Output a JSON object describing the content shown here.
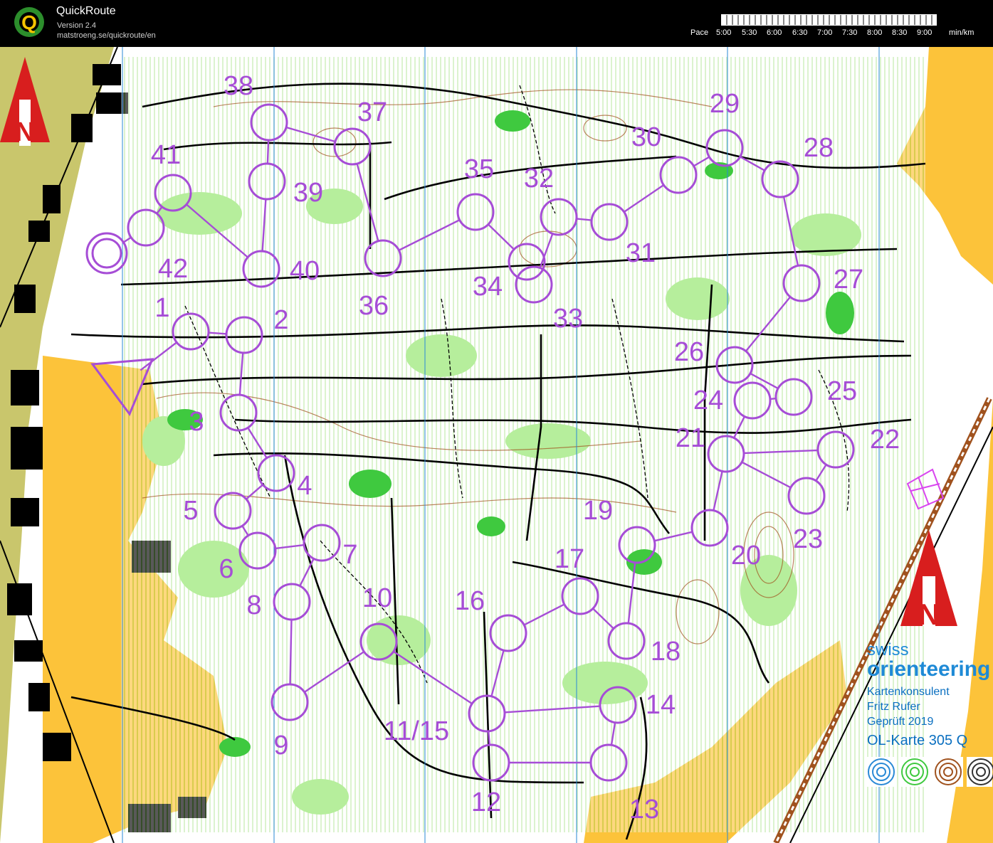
{
  "app": {
    "title": "QuickRoute",
    "version": "Version 2.4",
    "url": "matstroeng.se/quickroute/en"
  },
  "pace_scale": {
    "label": "Pace",
    "ticks": [
      "5:00",
      "5:30",
      "6:00",
      "6:30",
      "7:00",
      "7:30",
      "8:00",
      "8:30",
      "9:00"
    ],
    "unit": "min/km"
  },
  "course": {
    "color": "#a64dd6",
    "controls": [
      {
        "label": "1"
      },
      {
        "label": "2"
      },
      {
        "label": "3"
      },
      {
        "label": "4"
      },
      {
        "label": "5"
      },
      {
        "label": "6"
      },
      {
        "label": "7"
      },
      {
        "label": "8"
      },
      {
        "label": "9"
      },
      {
        "label": "10"
      },
      {
        "label": "11/15"
      },
      {
        "label": "12"
      },
      {
        "label": "13"
      },
      {
        "label": "14"
      },
      {
        "label": "16"
      },
      {
        "label": "17"
      },
      {
        "label": "18"
      },
      {
        "label": "19"
      },
      {
        "label": "20"
      },
      {
        "label": "21"
      },
      {
        "label": "22"
      },
      {
        "label": "23"
      },
      {
        "label": "24"
      },
      {
        "label": "25"
      },
      {
        "label": "26"
      },
      {
        "label": "27"
      },
      {
        "label": "28"
      },
      {
        "label": "29"
      },
      {
        "label": "30"
      },
      {
        "label": "31"
      },
      {
        "label": "32"
      },
      {
        "label": "33"
      },
      {
        "label": "34"
      },
      {
        "label": "35"
      },
      {
        "label": "36"
      },
      {
        "label": "37"
      },
      {
        "label": "38"
      },
      {
        "label": "39"
      },
      {
        "label": "40"
      },
      {
        "label": "41"
      },
      {
        "label": "42"
      }
    ]
  },
  "map_legend": {
    "brand_line1": "swiss",
    "brand_line2": "orienteering",
    "consultant_title": "Kartenkonsulent",
    "consultant_name": "Fritz Rufer",
    "checked": "Geprüft 2019",
    "map_id": "OL-Karte 305 Q",
    "north_letter": "N"
  },
  "colors": {
    "forest": "#ffffff",
    "green": "#3fc93f",
    "light_green": "#b6ee9c",
    "yellow": "#fcc33a",
    "olive": "#c9c66c",
    "brown": "#a0521e",
    "black": "#000000",
    "north_red": "#d81e1e",
    "meridian_blue": "#2a8ad6"
  }
}
